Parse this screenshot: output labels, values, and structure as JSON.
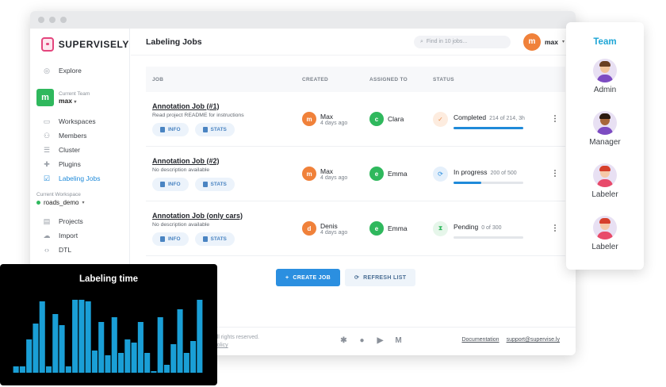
{
  "app": {
    "logo_text": "SUPERVISELY",
    "page_title": "Labeling Jobs",
    "search_placeholder": "Find in 10 jobs...",
    "user": {
      "initial": "m",
      "name": "max"
    }
  },
  "sidebar": {
    "explore": "Explore",
    "team": {
      "initial": "m",
      "label": "Current Team",
      "name": "max"
    },
    "team_items": [
      {
        "label": "Workspaces",
        "icon": "monitor-icon"
      },
      {
        "label": "Members",
        "icon": "users-icon"
      },
      {
        "label": "Cluster",
        "icon": "server-icon"
      },
      {
        "label": "Plugins",
        "icon": "puzzle-icon"
      },
      {
        "label": "Labeling Jobs",
        "icon": "checkbox-icon",
        "active": true
      }
    ],
    "workspace": {
      "label": "Current Workspace",
      "name": "roads_demo"
    },
    "workspace_items": [
      {
        "label": "Projects",
        "icon": "folder-icon"
      },
      {
        "label": "Import",
        "icon": "cloud-icon"
      },
      {
        "label": "DTL",
        "icon": "code-icon"
      }
    ]
  },
  "table": {
    "headers": [
      "JOB",
      "CREATED",
      "ASSIGNED TO",
      "STATUS"
    ],
    "info_label": "INFO",
    "stats_label": "STATS",
    "rows": [
      {
        "title": "Annotation Job (#1)",
        "desc": "Read project README for instructions",
        "created_initial": "m",
        "created_name": "Max",
        "created_date": "4 days ago",
        "created_color": "#f0813a",
        "assigned_initial": "c",
        "assigned_name": "Clara",
        "assigned_color": "#2fb85d",
        "status": "Completed",
        "count": "214 of 214, 3h",
        "progress": 1.0,
        "status_icon": "check-icon"
      },
      {
        "title": "Annotation Job (#2)",
        "desc": "No description available",
        "created_initial": "m",
        "created_name": "Max",
        "created_date": "4 days ago",
        "created_color": "#f0813a",
        "assigned_initial": "e",
        "assigned_name": "Emma",
        "assigned_color": "#2fb85d",
        "status": "In progress",
        "count": "200 of 500",
        "progress": 0.4,
        "status_icon": "sync-icon"
      },
      {
        "title": "Annotation Job (only cars)",
        "desc": "No description available",
        "created_initial": "d",
        "created_name": "Denis",
        "created_date": "4 days ago",
        "created_color": "#f0813a",
        "assigned_initial": "e",
        "assigned_name": "Emma",
        "assigned_color": "#2fb85d",
        "status": "Pending",
        "count": "0 of 300",
        "progress": 0.0,
        "status_icon": "hourglass-icon"
      }
    ]
  },
  "actions": {
    "create": "CREATE JOB",
    "refresh": "REFRESH LIST"
  },
  "footer": {
    "copy_line1": "All rights reserved.",
    "copy_line2": "Policy",
    "links": [
      "Documentation",
      "support@supervise.ly"
    ]
  },
  "team_panel": {
    "title": "Team",
    "members": [
      "Admin",
      "Manager",
      "Labeler",
      "Labeler"
    ]
  },
  "chart_data": {
    "type": "bar",
    "title": "Labeling time",
    "xlabel": "",
    "ylabel": "",
    "values": [
      0.08,
      0.08,
      0.42,
      0.62,
      0.9,
      0.08,
      0.74,
      0.6,
      0.08,
      0.92,
      0.92,
      0.9,
      0.28,
      0.64,
      0.22,
      0.7,
      0.25,
      0.42,
      0.38,
      0.64,
      0.25,
      0.02,
      0.7,
      0.1,
      0.36,
      0.8,
      0.25,
      0.4,
      0.92
    ],
    "color": "#1a9fd6"
  }
}
